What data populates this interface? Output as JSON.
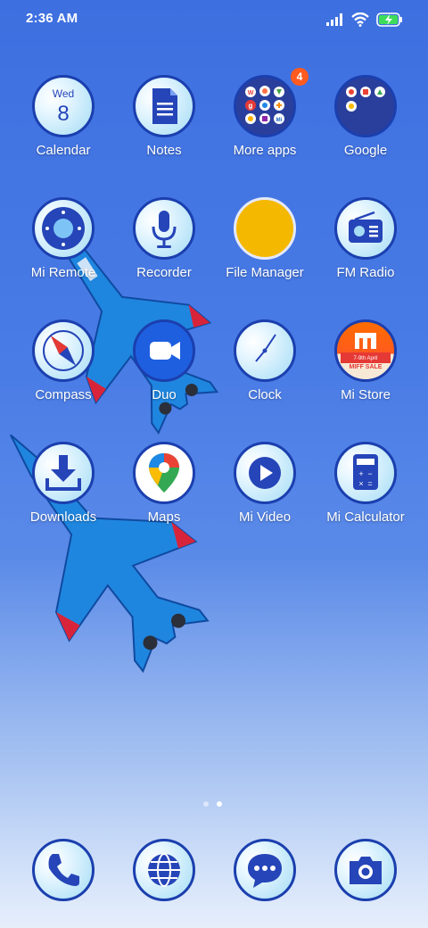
{
  "status_bar": {
    "time": "2:36 AM",
    "icons": [
      "signal-icon",
      "wifi-icon",
      "battery-charging-icon"
    ]
  },
  "calendar": {
    "day": "Wed",
    "date": "8"
  },
  "apps": [
    {
      "label": "Calendar"
    },
    {
      "label": "Notes"
    },
    {
      "label": "More apps",
      "badge": "4"
    },
    {
      "label": "Google"
    },
    {
      "label": "Mi Remote"
    },
    {
      "label": "Recorder"
    },
    {
      "label": "File Manager"
    },
    {
      "label": "FM Radio"
    },
    {
      "label": "Compass"
    },
    {
      "label": "Duo"
    },
    {
      "label": "Clock"
    },
    {
      "label": "Mi Store",
      "promo_line1": "7-9th April",
      "promo_line2": "MIFF SALE"
    },
    {
      "label": "Downloads"
    },
    {
      "label": "Maps"
    },
    {
      "label": "Mi Video"
    },
    {
      "label": "Mi Calculator"
    }
  ],
  "more_apps_folder": {
    "tile_letters": [
      "W",
      "g",
      "Mi"
    ]
  },
  "page_indicator": {
    "pages": 2,
    "active": 2
  },
  "dock": [
    {
      "icon": "phone-icon"
    },
    {
      "icon": "browser-globe-icon"
    },
    {
      "icon": "messages-icon"
    },
    {
      "icon": "camera-icon"
    }
  ],
  "colors": {
    "icon_border": "#1b3fae",
    "icon_glyph": "#2545b8",
    "badge": "#ff5a1f",
    "folder": "#2a3f9c",
    "file_manager": "#f5b800"
  }
}
